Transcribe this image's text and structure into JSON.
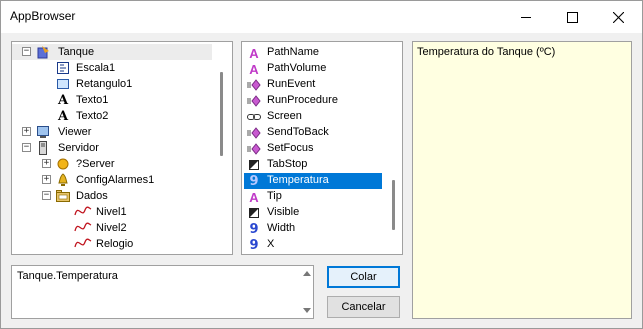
{
  "window": {
    "title": "AppBrowser"
  },
  "tree": {
    "items": [
      {
        "label": "Tanque",
        "icon": "container-icon",
        "expander": "−",
        "selected": true
      },
      {
        "label": "Escala1",
        "icon": "scale-icon"
      },
      {
        "label": "Retangulo1",
        "icon": "rectangle-icon"
      },
      {
        "label": "Texto1",
        "icon": "text-icon"
      },
      {
        "label": "Texto2",
        "icon": "text-icon"
      },
      {
        "label": "Viewer",
        "icon": "viewer-icon",
        "expander": "+"
      },
      {
        "label": "Servidor",
        "icon": "server-icon",
        "expander": "−"
      },
      {
        "label": "?Server",
        "icon": "server-object-icon",
        "expander": "+"
      },
      {
        "label": "ConfigAlarmes1",
        "icon": "alarm-config-icon",
        "expander": "+"
      },
      {
        "label": "Dados",
        "icon": "data-folder-icon",
        "expander": "−"
      },
      {
        "label": "Nivel1",
        "icon": "tag-icon"
      },
      {
        "label": "Nivel2",
        "icon": "tag-icon"
      },
      {
        "label": "Relogio",
        "icon": "tag-icon"
      }
    ]
  },
  "properties": {
    "items": [
      {
        "label": "PathName",
        "icon": "string-property-icon"
      },
      {
        "label": "PathVolume",
        "icon": "string-property-icon"
      },
      {
        "label": "RunEvent",
        "icon": "method-icon"
      },
      {
        "label": "RunProcedure",
        "icon": "method-icon"
      },
      {
        "label": "Screen",
        "icon": "object-link-icon"
      },
      {
        "label": "SendToBack",
        "icon": "method-icon"
      },
      {
        "label": "SetFocus",
        "icon": "method-icon"
      },
      {
        "label": "TabStop",
        "icon": "boolean-property-icon"
      },
      {
        "label": "Temperatura",
        "icon": "numeric-property-icon",
        "selected": true
      },
      {
        "label": "Tip",
        "icon": "string-property-icon"
      },
      {
        "label": "Visible",
        "icon": "boolean-property-icon"
      },
      {
        "label": "Width",
        "icon": "numeric-property-icon"
      },
      {
        "label": "X",
        "icon": "numeric-property-icon"
      }
    ]
  },
  "description": {
    "text": "Temperatura do Tanque (ºC)"
  },
  "expression": {
    "value": "Tanque.Temperatura"
  },
  "buttons": {
    "ok_label": "Colar",
    "cancel_label": "Cancelar"
  },
  "colors": {
    "selection": "#0078d7",
    "description_bg": "#ffffe1"
  }
}
